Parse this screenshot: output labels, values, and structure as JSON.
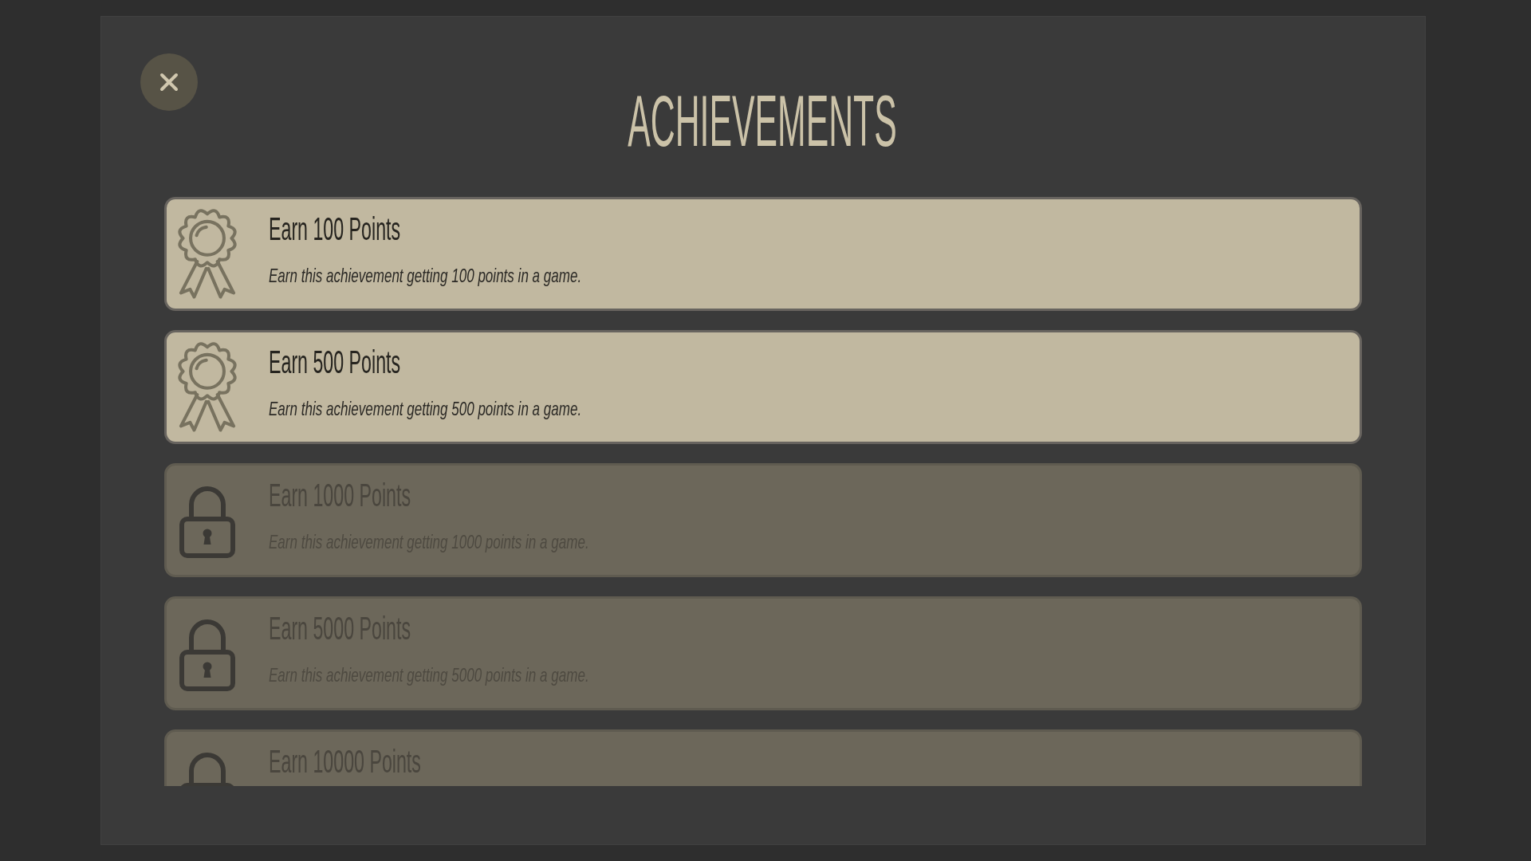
{
  "title": "ACHIEVEMENTS",
  "achievements": [
    {
      "title": "Earn 100 Points",
      "description": "Earn this achievement getting 100 points in a game.",
      "unlocked": true
    },
    {
      "title": "Earn 500 Points",
      "description": "Earn this achievement getting 500 points in a game.",
      "unlocked": true
    },
    {
      "title": "Earn 1000 Points",
      "description": "Earn this achievement getting 1000 points in a game.",
      "unlocked": false
    },
    {
      "title": "Earn 5000 Points",
      "description": "Earn this achievement getting 5000 points in a game.",
      "unlocked": false
    },
    {
      "title": "Earn 10000 Points",
      "unlocked": false
    }
  ]
}
